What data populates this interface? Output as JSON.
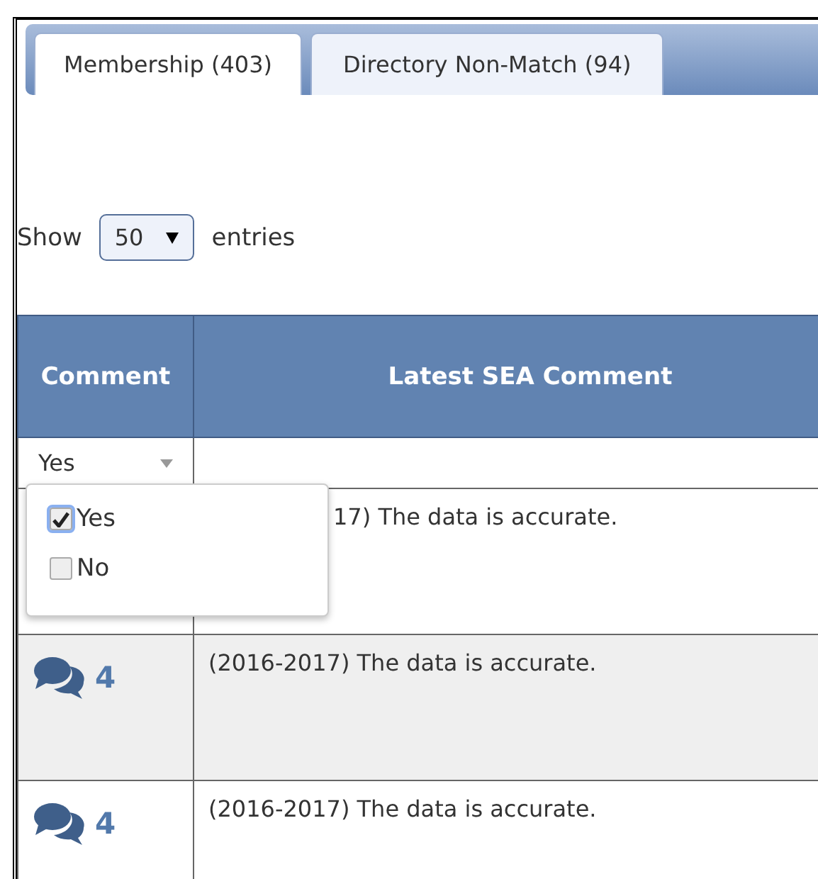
{
  "tabs": [
    {
      "label": "Membership (403)",
      "selected": true
    },
    {
      "label": "Directory Non-Match (94)",
      "selected": false
    }
  ],
  "length_menu": {
    "before": "Show",
    "value": "50",
    "after": "entries"
  },
  "table": {
    "columns": [
      "Comment",
      "Latest SEA Comment"
    ],
    "filter": {
      "value": "Yes"
    },
    "rows": [
      {
        "comment": "17) The data is accurate."
      },
      {
        "count": "4",
        "comment": "(2016-2017) The data is accurate."
      },
      {
        "count": "4",
        "comment": "(2016-2017) The data is accurate."
      }
    ]
  },
  "filter_dropdown": {
    "options": [
      {
        "label": "Yes",
        "checked": true
      },
      {
        "label": "No",
        "checked": false
      }
    ]
  }
}
